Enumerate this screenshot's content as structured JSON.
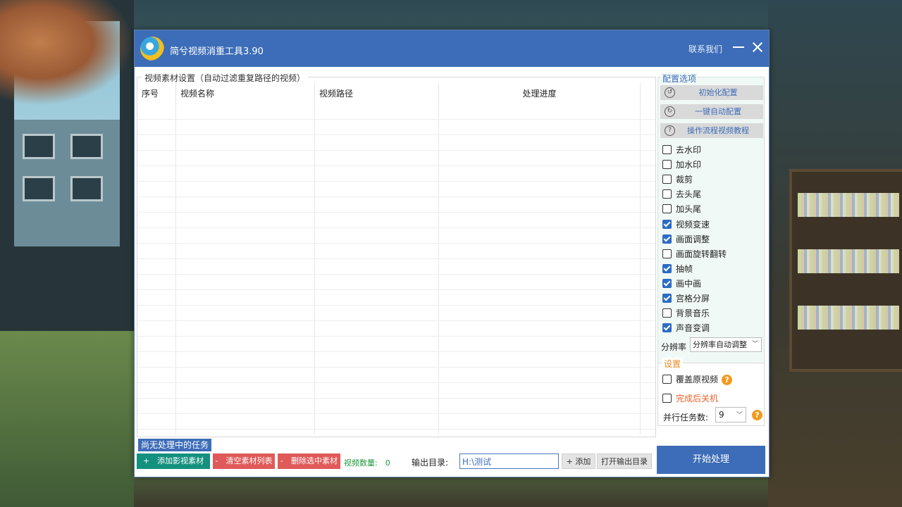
{
  "window": {
    "title": "简兮视频消重工具3.90",
    "contact_label": "联系我们"
  },
  "material_group": {
    "legend": "视频素材设置（自动过滤重复路径的视频）",
    "columns": [
      "序号",
      "视频名称",
      "视频路径",
      "处理进度"
    ]
  },
  "status": {
    "text": "尚无处理中的任务"
  },
  "toolbar": {
    "add_material": "+　添加影视素材",
    "clear_list": "-　清空素材列表",
    "delete_selected": "-　删除选中素材",
    "video_count": "视频数量:　0",
    "output_label": "输出目录:",
    "output_value": "H:\\测试",
    "add_dir": "+ 添加",
    "open_dir": "打开输出目录"
  },
  "config": {
    "legend": "配置选项",
    "buttons": [
      {
        "label": "初始化配置",
        "icon": "reset-icon"
      },
      {
        "label": "一键自动配置",
        "icon": "auto-config-icon"
      },
      {
        "label": "操作流程视频教程",
        "icon": "help-circle-icon"
      }
    ],
    "options": [
      {
        "label": "去水印",
        "checked": false
      },
      {
        "label": "加水印",
        "checked": false
      },
      {
        "label": "裁剪",
        "checked": false
      },
      {
        "label": "去头尾",
        "checked": false
      },
      {
        "label": "加头尾",
        "checked": false
      },
      {
        "label": "视频变速",
        "checked": true
      },
      {
        "label": "画面调整",
        "checked": true
      },
      {
        "label": "画面旋转翻转",
        "checked": false
      },
      {
        "label": "抽帧",
        "checked": true
      },
      {
        "label": "画中画",
        "checked": true
      },
      {
        "label": "宫格分屏",
        "checked": true
      },
      {
        "label": "背景音乐",
        "checked": false
      },
      {
        "label": "声音变调",
        "checked": true
      }
    ],
    "resolution_label": "分辨率",
    "resolution_value": "分辨率自动调整"
  },
  "settings": {
    "legend": "设置",
    "overwrite_label": "覆盖原视频",
    "overwrite_checked": false,
    "shutdown_label": "完成后关机",
    "shutdown_checked": false,
    "parallel_label": "并行任务数:",
    "parallel_value": "9"
  },
  "start_button": "开始处理",
  "colors": {
    "titlebar": "#3d6db8",
    "add_button": "#14907f",
    "delete_button": "#e05a5a",
    "help_icon": "#f39a1e"
  }
}
